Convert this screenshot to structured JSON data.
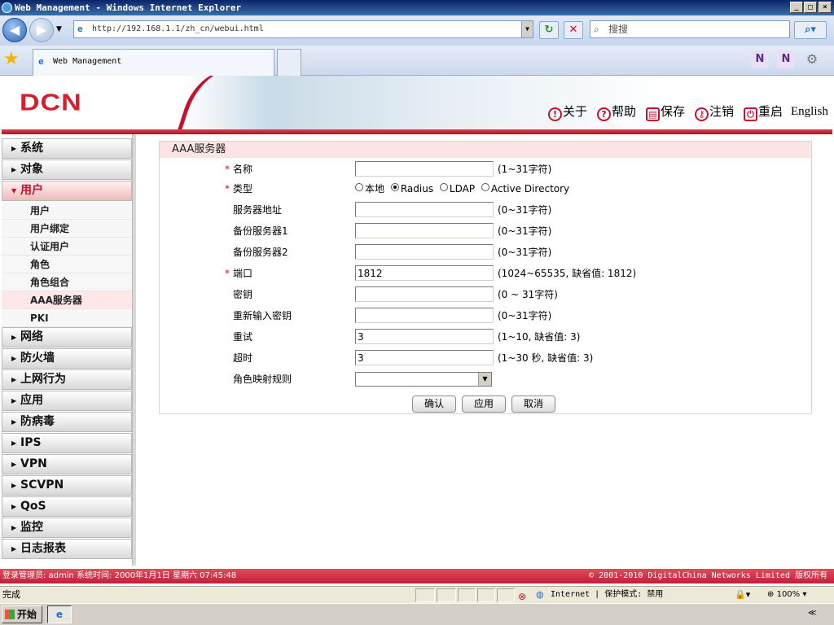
{
  "window": {
    "title": "Web Management - Windows Internet Explorer",
    "min": "_",
    "max": "□",
    "close": "×"
  },
  "address": {
    "url": "http://192.168.1.1/zh_cn/webui.html"
  },
  "search": {
    "placeholder": "搜搜"
  },
  "tab": {
    "label": "Web Management"
  },
  "header": {
    "logo": "DCN",
    "links": [
      {
        "icon": "!",
        "label": "关于"
      },
      {
        "icon": "?",
        "label": "帮助"
      },
      {
        "icon": "▤",
        "label": "保存"
      },
      {
        "icon": "⚷",
        "label": "注销"
      },
      {
        "icon": "⏻",
        "label": "重启"
      }
    ],
    "english": "English"
  },
  "sidebar": {
    "menus": [
      "系统",
      "对象",
      "用户",
      "网络",
      "防火墙",
      "上网行为",
      "应用",
      "防病毒",
      "IPS",
      "VPN",
      "SCVPN",
      "QoS",
      "监控",
      "日志报表"
    ],
    "submenu": [
      "用户",
      "用户绑定",
      "认证用户",
      "角色",
      "角色组合",
      "AAA服务器",
      "PKI"
    ]
  },
  "form": {
    "title": "AAA服务器",
    "fields": [
      {
        "label": "名称",
        "required": "*",
        "value": "",
        "hint": "(1~31字符)"
      },
      {
        "label": "类型",
        "required": "*"
      },
      {
        "label": "服务器地址",
        "value": "",
        "hint": "(0~31字符)"
      },
      {
        "label": "备份服务器1",
        "value": "",
        "hint": "(0~31字符)"
      },
      {
        "label": "备份服务器2",
        "value": "",
        "hint": "(0~31字符)"
      },
      {
        "label": "端口",
        "required": "*",
        "value": "1812",
        "hint": "(1024~65535, 缺省值: 1812)"
      },
      {
        "label": "密钥",
        "value": "",
        "hint": "(0 ~ 31字符)"
      },
      {
        "label": "重新输入密钥",
        "value": "",
        "hint": "(0~31字符)"
      },
      {
        "label": "重试",
        "value": "3",
        "hint": "(1~10, 缺省值: 3)"
      },
      {
        "label": "超时",
        "value": "3",
        "hint": "(1~30 秒, 缺省值: 3)"
      },
      {
        "label": "角色映射规则",
        "value": ""
      }
    ],
    "types": [
      "本地",
      "Radius",
      "LDAP",
      "Active Directory"
    ],
    "selected_type": "Radius",
    "buttons": {
      "ok": "确认",
      "apply": "应用",
      "cancel": "取消"
    }
  },
  "footer": {
    "left": "登录管理员: admin 系统时间: 2000年1月1日 星期六 07:45:48",
    "right": "© 2001-2010 DigitalChina Networks Limited 版权所有"
  },
  "status": {
    "text": "完成",
    "zone": "Internet | 保护模式: 禁用",
    "zoom": "100%"
  },
  "taskbar": {
    "start": "开始"
  },
  "colors": {
    "brand_red": "#c8102e",
    "panel_header": "#fbe4e4"
  }
}
